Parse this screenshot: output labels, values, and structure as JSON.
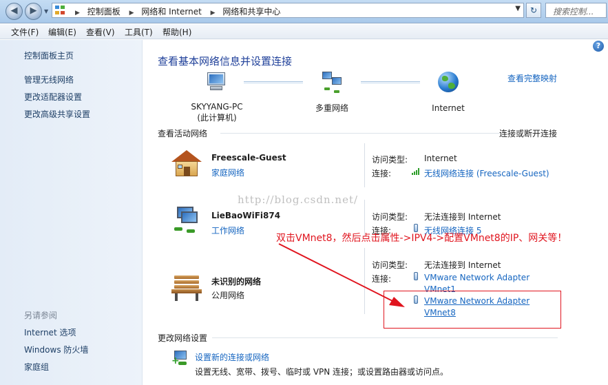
{
  "addressbar": {
    "crumbs": [
      "控制面板",
      "网络和 Internet",
      "网络和共享中心"
    ],
    "search_placeholder": "搜索控制..."
  },
  "menubar": {
    "items": [
      "文件(F)",
      "编辑(E)",
      "查看(V)",
      "工具(T)",
      "帮助(H)"
    ]
  },
  "sidebar": {
    "links": [
      "控制面板主页",
      "管理无线网络",
      "更改适配器设置",
      "更改高级共享设置"
    ],
    "see_also_header": "另请参阅",
    "see_also": [
      "Internet 选项",
      "Windows 防火墙",
      "家庭组"
    ]
  },
  "main": {
    "title": "查看基本网络信息并设置连接",
    "full_map_link": "查看完整映射",
    "map": {
      "computer_name": "SKYYANG-PC",
      "computer_sub": "(此计算机)",
      "multi": "多重网络",
      "internet": "Internet"
    },
    "active_label": "查看活动网络",
    "connect_link": "连接或断开连接",
    "access_type_label": "访问类型:",
    "connections_label": "连接:",
    "networks": [
      {
        "name": "Freescale-Guest",
        "type": "家庭网络",
        "access": "Internet",
        "connections": [
          "无线网络连接 (Freescale-Guest)"
        ]
      },
      {
        "name": "LieBaoWiFi874",
        "type": "工作网络",
        "access": "无法连接到 Internet",
        "connections": [
          "无线网络连接 5"
        ]
      },
      {
        "name": "未识别的网络",
        "type": "公用网络",
        "access": "无法连接到 Internet",
        "connections": [
          "VMware Network Adapter",
          "VMnet1",
          "VMware Network Adapter ",
          "VMnet8"
        ]
      }
    ],
    "change_settings_label": "更改网络设置",
    "tasks": [
      {
        "link": "设置新的连接或网络",
        "desc": "设置无线、宽带、拨号、临时或 VPN 连接；或设置路由器或访问点。"
      }
    ]
  },
  "overlay": {
    "watermark": "http://blog.csdn.net/",
    "annotation": "双击VMnet8，然后点击属性->IPV4->配置VMnet8的IP、网关等！"
  }
}
